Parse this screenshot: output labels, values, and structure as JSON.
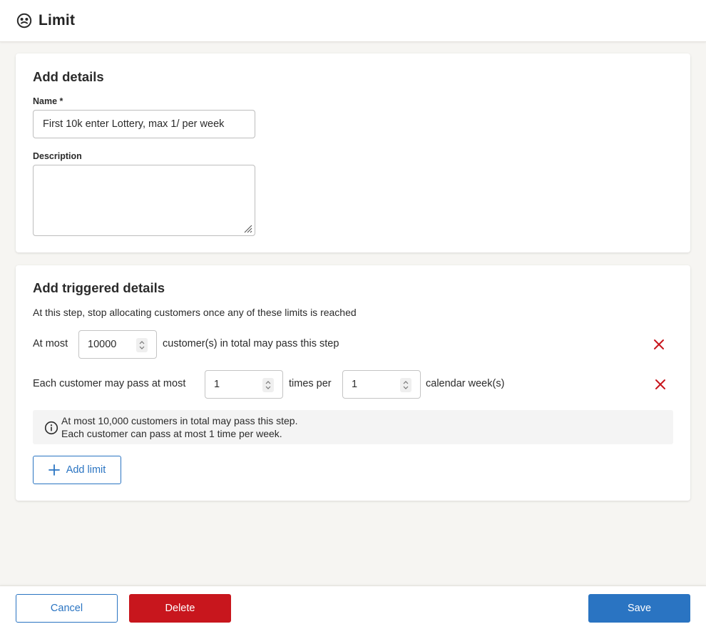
{
  "header": {
    "title": "Limit",
    "icon": "limit-gauge-icon"
  },
  "details": {
    "heading": "Add details",
    "name_label": "Name *",
    "name_value": "First 10k enter Lottery, max 1/ per week",
    "description_label": "Description",
    "description_value": ""
  },
  "triggered": {
    "heading": "Add triggered details",
    "subtext": "At this step, stop allocating customers once any of these limits is reached",
    "limit1": {
      "prefix": "At most",
      "value": "10000",
      "suffix": "customer(s) in total may pass this step"
    },
    "limit2": {
      "prefix": "Each customer may pass at most",
      "value": "1",
      "middle": "times per",
      "period_value": "1",
      "suffix": "calendar week(s)"
    },
    "info_line1": "At most 10,000 customers in total may pass this step.",
    "info_line2": "Each customer can pass at most 1 time per week.",
    "add_limit_label": "Add limit"
  },
  "footer": {
    "cancel_label": "Cancel",
    "delete_label": "Delete",
    "save_label": "Save"
  },
  "colors": {
    "primary": "#2a74c2",
    "danger": "#c8161d",
    "background": "#f6f5f2"
  }
}
